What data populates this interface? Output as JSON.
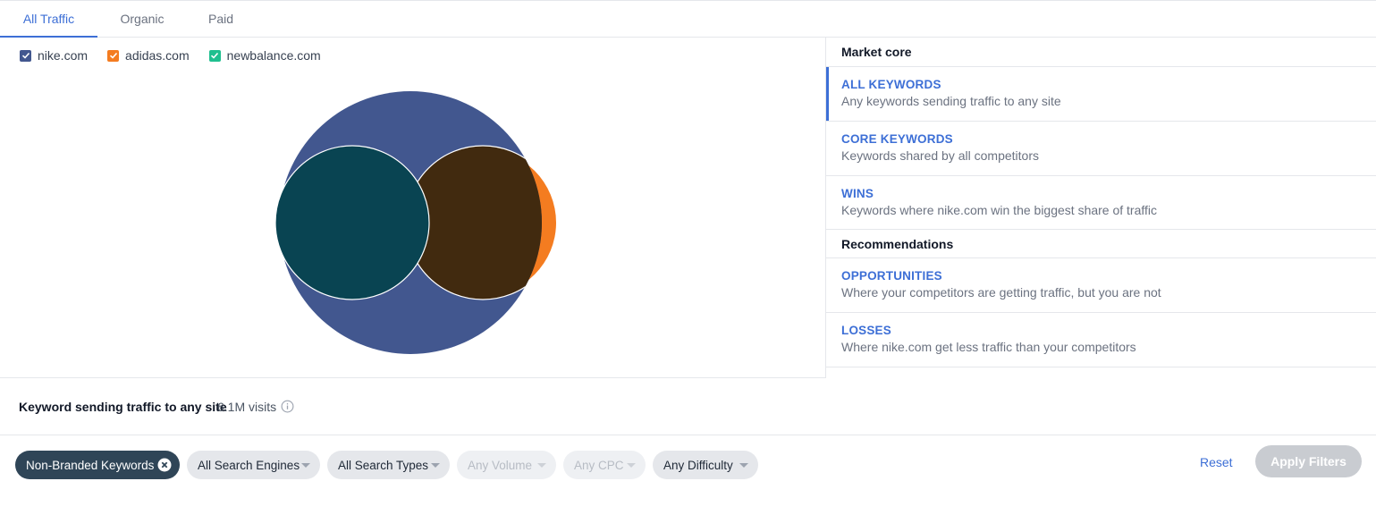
{
  "tabs": [
    {
      "label": "All Traffic",
      "active": true
    },
    {
      "label": "Organic",
      "active": false
    },
    {
      "label": "Paid",
      "active": false
    }
  ],
  "legend": [
    {
      "label": "nike.com",
      "color": "#42578f",
      "checked": true
    },
    {
      "label": "adidas.com",
      "color": "#f47c20",
      "checked": true
    },
    {
      "label": "newbalance.com",
      "color": "#1fbf8f",
      "checked": true
    }
  ],
  "venn_colors": {
    "nike": "#42578f",
    "adidas": "#f47c20",
    "newbalance": "#1fbf8f",
    "overlap_newbalance": "#094452",
    "overlap_adidas": "#412a0f"
  },
  "sidebar": {
    "market_core_header": "Market core",
    "market_core_items": [
      {
        "title": "ALL KEYWORDS",
        "desc": "Any keywords sending traffic to any site",
        "active": true
      },
      {
        "title": "CORE KEYWORDS",
        "desc": "Keywords shared by all competitors",
        "active": false
      },
      {
        "title": "WINS",
        "desc": "Keywords where nike.com win the biggest share of traffic",
        "active": false
      }
    ],
    "recommendations_header": "Recommendations",
    "recommendations_items": [
      {
        "title": "OPPORTUNITIES",
        "desc": "Where your competitors are getting traffic, but you are not"
      },
      {
        "title": "LOSSES",
        "desc": "Where nike.com get less traffic than your competitors"
      }
    ]
  },
  "summary": {
    "label": "Keyword sending traffic to any site",
    "value": "6.1M visits",
    "info_icon": "info-icon"
  },
  "filters": {
    "active_chip": "Non-Branded Keywords",
    "search_engines": "All Search Engines",
    "search_types": "All Search Types",
    "volume": "Any Volume",
    "cpc": "Any CPC",
    "difficulty": "Any Difficulty",
    "reset": "Reset",
    "apply": "Apply Filters"
  }
}
